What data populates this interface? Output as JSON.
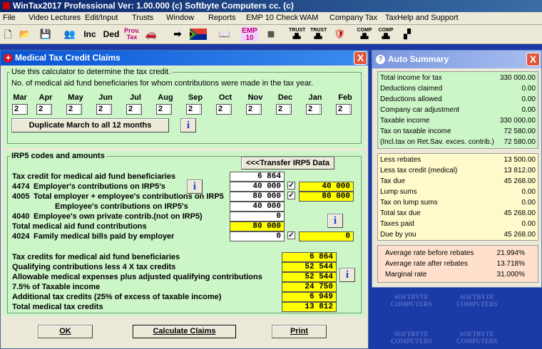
{
  "app_title": "WinTax2017 Professional Ver: 1.00.000  (c) Softbyte Computers cc.  (c)",
  "menu": [
    "File",
    "Video Lectures",
    "Edit/Input",
    "Trusts",
    "Window",
    "Reports",
    "EMP 10 Check",
    "WAM",
    "Company Tax",
    "TaxHelp and Support"
  ],
  "toolbar": {
    "inc": "Inc",
    "ded": "Ded",
    "prov": "Prov.",
    "tax": "Tax",
    "emp": "EMP",
    "ten": "10",
    "trust1": "TRUST",
    "trust2": "TRUST",
    "comp1": "COMP",
    "comp2": "COMP"
  },
  "watermark": {
    "line1": "SOFTBYTE",
    "line2": "COMPUTERS"
  },
  "medical": {
    "title": "Medical Tax Credit Claims",
    "close": "X",
    "group1_title": "Use this calculator to determine the tax credit.",
    "group1_desc": "No. of medical aid fund beneficiaries for whom contributions were made in the tax year.",
    "months": [
      {
        "label": "Mar",
        "value": "2"
      },
      {
        "label": "Apr",
        "value": "2"
      },
      {
        "label": "May",
        "value": "2"
      },
      {
        "label": "Jun",
        "value": "2"
      },
      {
        "label": "Jul",
        "value": "2"
      },
      {
        "label": "Aug",
        "value": "2"
      },
      {
        "label": "Sep",
        "value": "2"
      },
      {
        "label": "Oct",
        "value": "2"
      },
      {
        "label": "Nov",
        "value": "2"
      },
      {
        "label": "Dec",
        "value": "2"
      },
      {
        "label": "Jan",
        "value": "2"
      },
      {
        "label": "Feb",
        "value": "2"
      }
    ],
    "duplicate_btn": "Duplicate March to all 12 months",
    "info": "i",
    "group2_title": "IRP5 codes and amounts",
    "transfer_btn": "<<<Transfer IRP5 Data",
    "rows": {
      "credit_label": "Tax credit for medical aid fund beneficiaries",
      "credit_val": "6 864",
      "r4474_code": "4474",
      "r4474_label": "Employer's contributions on IRP5's",
      "r4474_val": "40 000",
      "r4474_yellow": "40 000",
      "r4005_code": "4005",
      "r4005_label": "Total employer + employee's contributions on IRP5",
      "r4005_val": "80 000",
      "r4005_yellow": "80 000",
      "emp_label": "Employee's contributions on IRP5's",
      "emp_val": "40 000",
      "r4040_code": "4040",
      "r4040_label": "Employee's own private contrib.(not on IRP5)",
      "r4040_val": "0",
      "total_label": "Total medical aid fund contributions",
      "total_val": "80 000",
      "r4024_code": "4024",
      "r4024_label": "Family medical bills paid by employer",
      "r4024_val": "0",
      "r4024_yellow": "0"
    },
    "check": "✓",
    "results": [
      {
        "label": "Tax credits for medical aid fund beneficiaries",
        "value": "6 864"
      },
      {
        "label": "Qualifying contributions less 4 X tax credits",
        "value": "52 544"
      },
      {
        "label": "Allowable medical expenses plus adjusted qualifying contributions",
        "value": "52 544"
      },
      {
        "label": "7.5% of Taxable income",
        "value": "24 750"
      },
      {
        "label": "Additional tax credits  (25% of excess of taxable income)",
        "value": "6 949"
      },
      {
        "label": "Total medical tax credits",
        "value": "13 812"
      }
    ],
    "ok_btn": "OK",
    "calc_btn": "Calculate Claims",
    "print_btn": "Print"
  },
  "summary": {
    "title": "Auto Summary",
    "close": "X",
    "section1": [
      {
        "label": "Total income for tax",
        "value": "330 000.00"
      },
      {
        "label": "Deductions claimed",
        "value": "0.00"
      },
      {
        "label": "Deductions allowed",
        "value": "0.00"
      },
      {
        "label": "Company car adjustment",
        "value": "0.00"
      },
      {
        "label": "Taxable income",
        "value": "330 000.00"
      },
      {
        "label": "Tax on taxable income",
        "value": "72 580.00"
      },
      {
        "label": "(Incl.tax on Ret.Sav. exces. contrib.)",
        "value": "72 580.00"
      }
    ],
    "section2": [
      {
        "label": "Less rebates",
        "value": "13 500.00"
      },
      {
        "label": "Less tax credit (medical)",
        "value": "13 812.00"
      },
      {
        "label": "Tax due",
        "value": "45 268.00"
      },
      {
        "label": "Lump sums",
        "value": "0.00"
      },
      {
        "label": "Tax on lump sums",
        "value": "0.00"
      },
      {
        "label": "Total tax due",
        "value": "45 268.00"
      },
      {
        "label": "Taxes paid",
        "value": "0.00"
      },
      {
        "label": "Due by you",
        "value": "45 268.00"
      }
    ],
    "section3": [
      {
        "label": "Average rate before rebates",
        "value": "21.994%"
      },
      {
        "label": "Average rate after rebates",
        "value": "13.718%"
      },
      {
        "label": "Marginal rate",
        "value": "31.000%"
      }
    ]
  },
  "colors": {
    "green_panel": "#ccf5c8",
    "yellow_panel": "#fffacc",
    "pink_panel": "#ffe0cc",
    "title_blue": "#0854d5",
    "field_yellow": "#ffff00"
  }
}
